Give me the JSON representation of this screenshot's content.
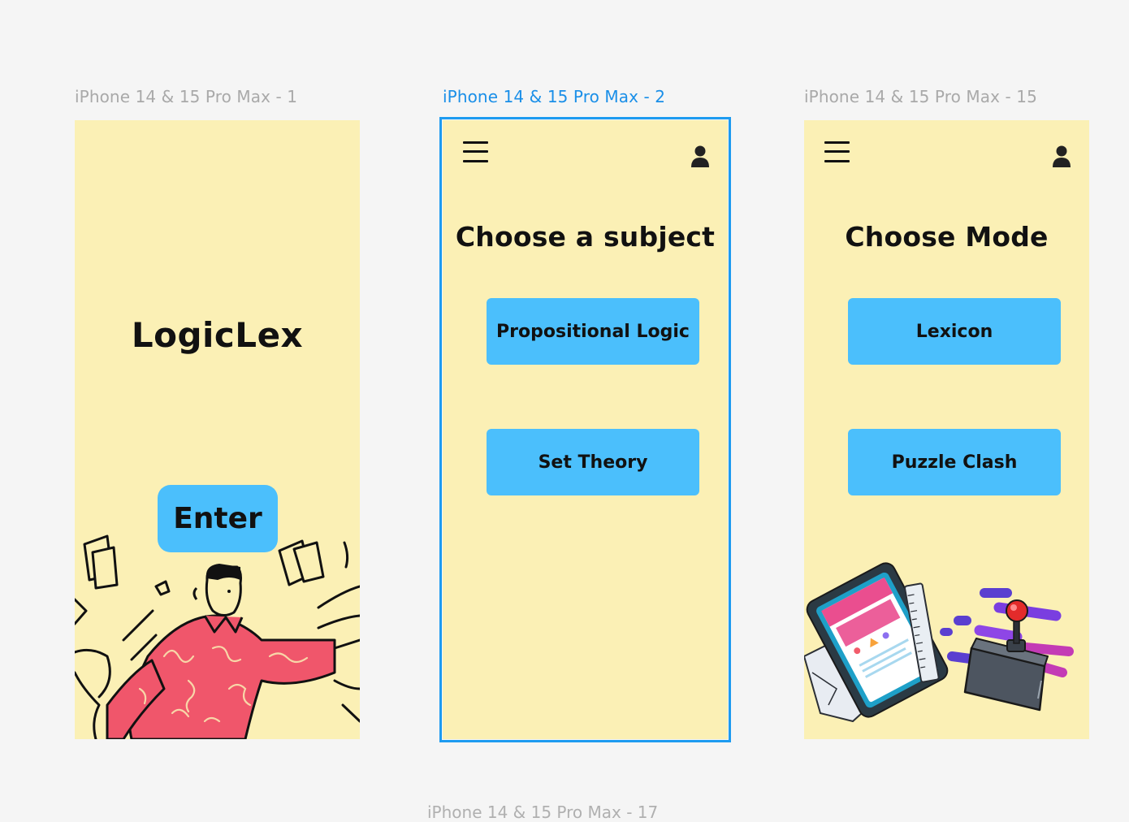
{
  "frames": [
    {
      "label": "iPhone 14 & 15 Pro Max - 1",
      "app_title": "LogicLex",
      "enter_label": "Enter"
    },
    {
      "label": "iPhone 14 & 15 Pro Max - 2",
      "title": "Choose a subject",
      "buttons": [
        "Propositional Logic",
        "Set Theory"
      ]
    },
    {
      "label": "iPhone 14 & 15 Pro Max - 15",
      "title": "Choose Mode",
      "buttons": [
        "Lexicon",
        "Puzzle Clash"
      ]
    }
  ],
  "bottom_label": "iPhone 14 & 15 Pro Max - 17",
  "icons": {
    "menu": "hamburger-menu-icon",
    "profile": "user-profile-icon"
  },
  "colors": {
    "canvas": "#f5f5f5",
    "frame_bg": "#fbf0b5",
    "button": "#4bbffc",
    "selection": "#1e9bf0"
  }
}
